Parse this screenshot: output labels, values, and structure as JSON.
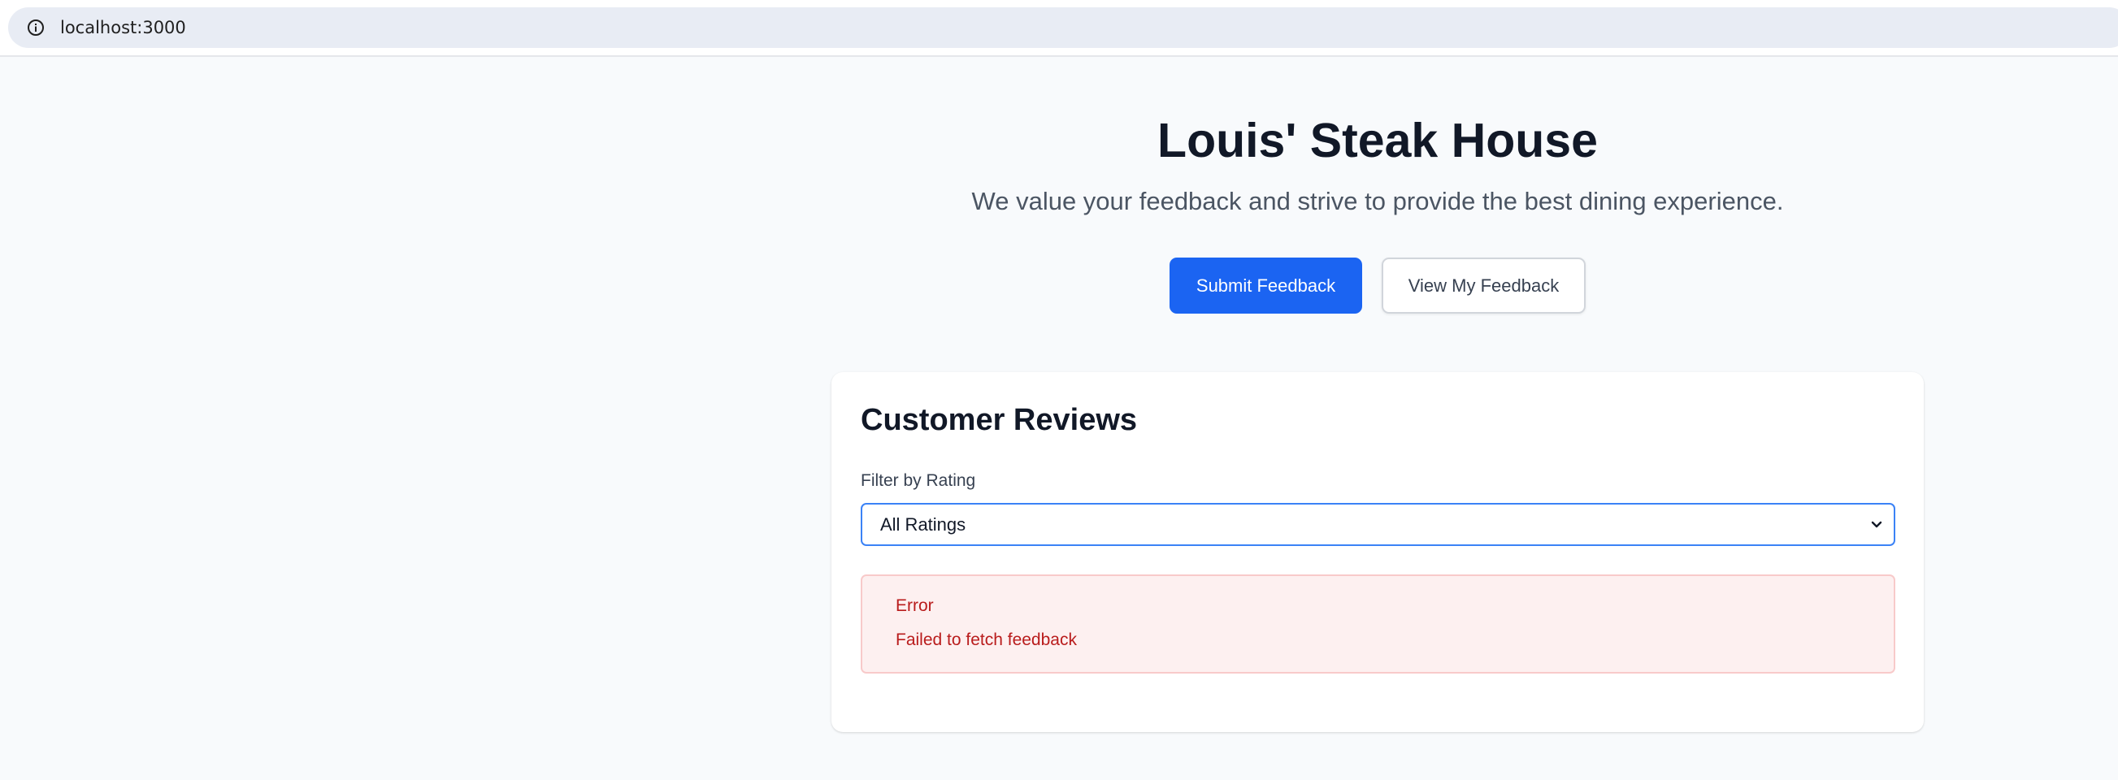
{
  "browser": {
    "url": "localhost:3000",
    "info_icon": "info-icon"
  },
  "hero": {
    "title": "Louis' Steak House",
    "subtitle": "We value your feedback and strive to provide the best dining experience.",
    "submit_button": "Submit Feedback",
    "view_button": "View My Feedback"
  },
  "reviews": {
    "title": "Customer Reviews",
    "filter_label": "Filter by Rating",
    "filter_selected": "All Ratings",
    "error_title": "Error",
    "error_message": "Failed to fetch feedback"
  },
  "colors": {
    "primary": "#1b64f2",
    "error_text": "#b91c1c",
    "error_bg": "#fdf0f0",
    "page_bg": "#f8fafc"
  }
}
